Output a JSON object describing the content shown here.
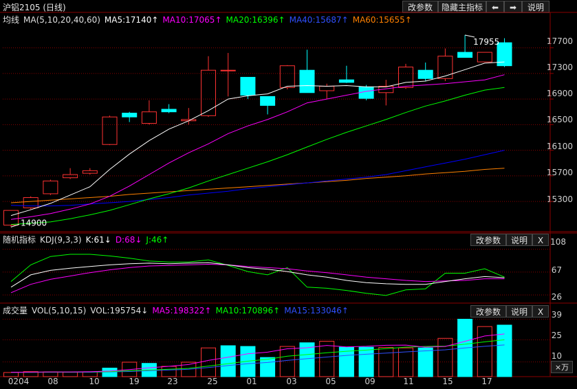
{
  "window": {
    "title": "沪铝2105 (日线)"
  },
  "toolbar": {
    "change_params": "改参数",
    "hide_main_indicator": "隐藏主指标",
    "help": "说明",
    "back_arrow": "⬅",
    "forward_arrow": "➡"
  },
  "main_panel": {
    "indicator_name": "均线",
    "indicator_params": "MA(5,10,20,40,60)",
    "ma5": "MA5:17140↑",
    "ma10": "MA10:17065↑",
    "ma20": "MA20:16396↑",
    "ma40": "MA40:15687↑",
    "ma60": "MA60:15655↑",
    "high_label": "17955",
    "low_label": "14900",
    "yticks": [
      "17700",
      "17300",
      "16900",
      "16500",
      "16100",
      "15700",
      "15300"
    ]
  },
  "kdj_panel": {
    "name": "随机指标",
    "params": "KDJ(9,3,3)",
    "k": "K:61↓",
    "d": "D:68↓",
    "j": "J:46↑",
    "change_params": "改参数",
    "help": "说明",
    "close": "X",
    "yticks": [
      "108",
      "67",
      "26"
    ]
  },
  "vol_panel": {
    "name": "成交量",
    "params": "VOL(5,10,15)",
    "vol": "VOL:195754↓",
    "ma5": "MA5:198322↑",
    "ma10": "MA10:170896↑",
    "ma15": "MA15:133046↑",
    "change_params": "改参数",
    "help": "说明",
    "close": "X",
    "yticks": [
      "39",
      "25",
      "10"
    ],
    "unit": "×万"
  },
  "xaxis": {
    "labels": [
      "0204",
      "08",
      "10",
      "19",
      "23",
      "25",
      "01",
      "03",
      "05",
      "09",
      "11",
      "15",
      "17"
    ]
  },
  "colors": {
    "up": "#ff3232",
    "down": "#00ffff",
    "ma5": "#ffffff",
    "ma10": "#ff00ff",
    "ma20": "#00ff00",
    "ma40": "#0000ff",
    "ma60": "#ff8000",
    "grid": "#8b0000",
    "k": "#ffffff",
    "d": "#ff00ff",
    "j": "#00ff00"
  },
  "chart_data": {
    "type": "candlestick",
    "candles": [
      {
        "o": 14930,
        "c": 15160,
        "h": 15160,
        "l": 14900
      },
      {
        "o": 15200,
        "c": 15360,
        "h": 15380,
        "l": 15180
      },
      {
        "o": 15420,
        "c": 15620,
        "h": 15640,
        "l": 15400
      },
      {
        "o": 15670,
        "c": 15720,
        "h": 15820,
        "l": 15650
      },
      {
        "o": 15740,
        "c": 15780,
        "h": 15820,
        "l": 15720
      },
      {
        "o": 16190,
        "c": 16620,
        "h": 16640,
        "l": 16180
      },
      {
        "o": 16680,
        "c": 16620,
        "h": 16700,
        "l": 16540
      },
      {
        "o": 16520,
        "c": 16700,
        "h": 16880,
        "l": 16500
      },
      {
        "o": 16740,
        "c": 16700,
        "h": 16820,
        "l": 16680
      },
      {
        "o": 16560,
        "c": 16580,
        "h": 16760,
        "l": 16500
      },
      {
        "o": 16640,
        "c": 17350,
        "h": 17570,
        "l": 16620
      },
      {
        "o": 17350,
        "c": 17350,
        "h": 17620,
        "l": 16940
      },
      {
        "o": 17240,
        "c": 16960,
        "h": 17240,
        "l": 16900
      },
      {
        "o": 16940,
        "c": 16800,
        "h": 16940,
        "l": 16660
      },
      {
        "o": 17080,
        "c": 17420,
        "h": 17430,
        "l": 17050
      },
      {
        "o": 17350,
        "c": 17000,
        "h": 17670,
        "l": 17000
      },
      {
        "o": 17030,
        "c": 17100,
        "h": 17140,
        "l": 16900
      },
      {
        "o": 17200,
        "c": 17160,
        "h": 17420,
        "l": 17150
      },
      {
        "o": 17090,
        "c": 16910,
        "h": 17120,
        "l": 16880
      },
      {
        "o": 17000,
        "c": 17100,
        "h": 17200,
        "l": 16800
      },
      {
        "o": 17080,
        "c": 17400,
        "h": 17450,
        "l": 17060
      },
      {
        "o": 17350,
        "c": 17220,
        "h": 17470,
        "l": 17180
      },
      {
        "o": 17220,
        "c": 17570,
        "h": 17690,
        "l": 17180
      },
      {
        "o": 17630,
        "c": 17550,
        "h": 17900,
        "l": 17550
      },
      {
        "o": 17480,
        "c": 17630,
        "h": 17630,
        "l": 17480
      },
      {
        "o": 17780,
        "c": 17420,
        "h": 17850,
        "l": 17400
      }
    ],
    "ma5": [
      15080,
      15170,
      15270,
      15400,
      15530,
      15800,
      16040,
      16250,
      16430,
      16560,
      16720,
      16900,
      16950,
      16980,
      17100,
      17110,
      17100,
      17110,
      17090,
      17090,
      17160,
      17180,
      17260,
      17360,
      17460,
      17480
    ],
    "ma10": [
      15020,
      15060,
      15110,
      15180,
      15260,
      15380,
      15540,
      15720,
      15900,
      16060,
      16200,
      16360,
      16480,
      16580,
      16700,
      16840,
      16900,
      16960,
      17020,
      17060,
      17100,
      17120,
      17140,
      17170,
      17200,
      17280
    ],
    "ma20": [
      14940,
      14960,
      14980,
      15030,
      15090,
      15160,
      15250,
      15340,
      15420,
      15510,
      15620,
      15720,
      15820,
      15920,
      16030,
      16150,
      16270,
      16380,
      16480,
      16580,
      16690,
      16790,
      16870,
      16960,
      17040,
      17080
    ],
    "ma40": [
      15240,
      15230,
      15230,
      15240,
      15260,
      15280,
      15300,
      15330,
      15360,
      15400,
      15430,
      15460,
      15500,
      15530,
      15560,
      15590,
      15620,
      15650,
      15680,
      15720,
      15780,
      15840,
      15900,
      15960,
      16030,
      16100
    ],
    "ma60": [
      15280,
      15300,
      15320,
      15340,
      15360,
      15380,
      15410,
      15430,
      15450,
      15470,
      15490,
      15510,
      15530,
      15550,
      15570,
      15590,
      15610,
      15630,
      15660,
      15680,
      15700,
      15730,
      15750,
      15770,
      15800,
      15820
    ],
    "kdj": {
      "k": [
        40,
        62,
        70,
        74,
        77,
        80,
        82,
        83,
        82,
        83,
        84,
        80,
        75,
        72,
        68,
        62,
        58,
        52,
        48,
        46,
        45,
        45,
        50,
        55,
        59,
        57
      ],
      "d": [
        30,
        45,
        54,
        60,
        66,
        71,
        75,
        78,
        79,
        80,
        81,
        80,
        77,
        75,
        73,
        69,
        66,
        62,
        58,
        55,
        52,
        50,
        51,
        52,
        55,
        55
      ],
      "j": [
        50,
        80,
        95,
        99,
        99,
        96,
        92,
        87,
        85,
        85,
        89,
        79,
        68,
        62,
        75,
        40,
        38,
        34,
        29,
        25,
        35,
        37,
        65,
        65,
        73,
        58
      ]
    },
    "volume": [
      {
        "v": 2.8,
        "up": true
      },
      {
        "v": 3.4,
        "up": true
      },
      {
        "v": 3.2,
        "up": true
      },
      {
        "v": 3.0,
        "up": true
      },
      {
        "v": 3.3,
        "up": true
      },
      {
        "v": 5.8,
        "up": false
      },
      {
        "v": 9.8,
        "up": true
      },
      {
        "v": 9.0,
        "up": false
      },
      {
        "v": 7.0,
        "up": true
      },
      {
        "v": 9.8,
        "up": true
      },
      {
        "v": 19.5,
        "up": true
      },
      {
        "v": 21.0,
        "up": false
      },
      {
        "v": 20.5,
        "up": false
      },
      {
        "v": 13.0,
        "up": false
      },
      {
        "v": 20.5,
        "up": true
      },
      {
        "v": 23.0,
        "up": false
      },
      {
        "v": 24.0,
        "up": true
      },
      {
        "v": 20.0,
        "up": false
      },
      {
        "v": 20.0,
        "up": false
      },
      {
        "v": 19.8,
        "up": true
      },
      {
        "v": 19.5,
        "up": true
      },
      {
        "v": 19.5,
        "up": false
      },
      {
        "v": 26.0,
        "up": true
      },
      {
        "v": 39.0,
        "up": false
      },
      {
        "v": 34.0,
        "up": true
      },
      {
        "v": 35.0,
        "up": false
      }
    ],
    "vol_ma5": [
      3.0,
      3.1,
      3.2,
      3.2,
      3.3,
      3.8,
      4.8,
      6.0,
      7.0,
      8.2,
      11.0,
      13.2,
      15.5,
      16.6,
      18.9,
      19.6,
      21.2,
      20.2,
      20.6,
      21.3,
      21.4,
      20.0,
      20.5,
      24.0,
      27.6,
      29.0
    ],
    "vol_ma10": [
      3.0,
      3.0,
      3.1,
      3.1,
      3.2,
      3.4,
      4.0,
      4.5,
      5.0,
      5.6,
      7.2,
      8.8,
      10.5,
      11.8,
      13.9,
      15.0,
      16.2,
      17.2,
      18.0,
      19.0,
      20.0,
      20.5,
      20.7,
      22.0,
      23.6,
      25.0
    ],
    "vol_ma15": [
      2.9,
      2.9,
      3.0,
      3.0,
      3.0,
      3.2,
      3.5,
      4.0,
      4.5,
      5.0,
      6.2,
      7.5,
      8.8,
      9.6,
      11.0,
      12.2,
      13.3,
      14.4,
      15.2,
      16.0,
      16.8,
      17.5,
      18.2,
      19.5,
      20.6,
      21.5
    ],
    "vol_ylim": [
      0,
      42
    ],
    "price_ylim": [
      14850,
      18050
    ],
    "kdj_ylim": [
      15,
      115
    ]
  }
}
